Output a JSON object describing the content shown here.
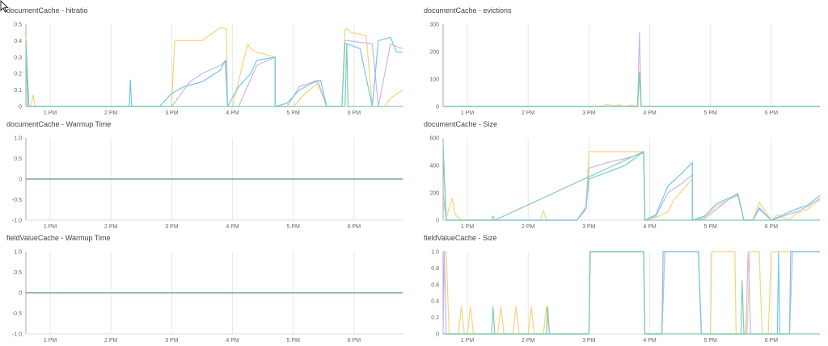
{
  "colors": {
    "yellow": "#f7d37a",
    "purple": "#c9b7e8",
    "cyan": "#6ccbe5",
    "green": "#7fcfa8",
    "grid": "#e8e8e8",
    "axis": "#aaaaaa"
  },
  "panels": [
    {
      "title": "documentCache - hitratio"
    },
    {
      "title": "documentCache - evictions"
    },
    {
      "title": "documentCache - Warmup Time"
    },
    {
      "title": "documentCache - Size"
    },
    {
      "title": "fieldValueCache - Warmup Time"
    },
    {
      "title": "fieldValueCache - Size"
    }
  ],
  "chart_data": [
    {
      "type": "line",
      "title": "documentCache - hitratio",
      "xlim": [
        12.6,
        18.8
      ],
      "ylim": [
        0,
        0.5
      ],
      "xticks": [
        13,
        14,
        15,
        16,
        17,
        18
      ],
      "xticklabels": [
        "1 PM",
        "2 PM",
        "3 PM",
        "4 PM",
        "5 PM",
        "6 PM"
      ],
      "yticks": [
        0,
        0.1,
        0.2,
        0.3,
        0.4,
        0.5
      ],
      "yticklabels": [
        "0",
        "0.1",
        "0.2",
        "0.3",
        "0.4",
        "0.5"
      ],
      "series": [
        {
          "color": "yellow",
          "x": [
            12.6,
            12.63,
            12.68,
            12.72,
            12.75,
            15.0,
            15.02,
            15.05,
            15.5,
            15.8,
            15.9,
            15.92,
            16.0,
            16.25,
            16.3,
            16.35,
            16.4,
            16.5,
            16.7,
            16.7,
            17.0,
            17.2,
            17.4,
            17.55,
            17.8,
            17.85,
            17.9,
            17.95,
            18.2,
            18.3,
            18.5,
            18.6,
            18.8
          ],
          "y": [
            0.42,
            0.0,
            0.0,
            0.07,
            0.0,
            0.0,
            0.2,
            0.4,
            0.4,
            0.48,
            0.47,
            0.0,
            0.0,
            0.38,
            0.35,
            0.34,
            0.33,
            0.32,
            0.3,
            0.0,
            0.0,
            0.08,
            0.14,
            0.0,
            0.0,
            0.47,
            0.47,
            0.45,
            0.43,
            0.0,
            0.0,
            0.05,
            0.1
          ]
        },
        {
          "color": "purple",
          "x": [
            12.6,
            12.65,
            13.2,
            13.4,
            14.2,
            15.0,
            15.3,
            15.5,
            15.8,
            15.9,
            15.92,
            16.1,
            16.4,
            16.7,
            16.7,
            16.9,
            17.1,
            17.4,
            17.55,
            17.8,
            17.85,
            17.9,
            18.3,
            18.4,
            18.6,
            18.8
          ],
          "y": [
            0.0,
            0.0,
            0.0,
            0.0,
            0.0,
            0.0,
            0.15,
            0.2,
            0.25,
            0.28,
            0.0,
            0.0,
            0.25,
            0.3,
            0.0,
            0.0,
            0.12,
            0.16,
            0.0,
            0.0,
            0.4,
            0.4,
            0.38,
            0.0,
            0.38,
            0.35
          ]
        },
        {
          "color": "cyan",
          "x": [
            12.6,
            12.65,
            13.2,
            14.3,
            14.32,
            14.34,
            14.8,
            15.0,
            15.2,
            15.5,
            15.8,
            15.88,
            15.92,
            16.1,
            16.3,
            16.4,
            16.7,
            16.7,
            16.9,
            17.1,
            17.3,
            17.45,
            17.55,
            17.8,
            17.85,
            17.9,
            18.1,
            18.3,
            18.4,
            18.6,
            18.7,
            18.8
          ],
          "y": [
            0.4,
            0.0,
            0.0,
            0.0,
            0.16,
            0.0,
            0.0,
            0.08,
            0.12,
            0.15,
            0.22,
            0.28,
            0.0,
            0.12,
            0.2,
            0.28,
            0.3,
            0.0,
            0.02,
            0.1,
            0.14,
            0.16,
            0.0,
            0.0,
            0.38,
            0.38,
            0.35,
            0.0,
            0.4,
            0.42,
            0.33,
            0.33
          ]
        },
        {
          "color": "green",
          "x": [
            12.6,
            12.63,
            17.85,
            17.88,
            17.9,
            17.95,
            18.8
          ],
          "y": [
            0.4,
            0.0,
            0.0,
            0.38,
            0.0,
            0.0,
            0.0
          ]
        }
      ]
    },
    {
      "type": "line",
      "title": "documentCache - evictions",
      "xlim": [
        12.6,
        18.8
      ],
      "ylim": [
        0,
        300
      ],
      "xticks": [
        13,
        14,
        15,
        16,
        17,
        18
      ],
      "xticklabels": [
        "1 PM",
        "2 PM",
        "3 PM",
        "4 PM",
        "5 PM",
        "6 PM"
      ],
      "yticks": [
        0,
        100,
        200,
        300
      ],
      "yticklabels": [
        "0",
        "100",
        "200",
        "300"
      ],
      "series": [
        {
          "color": "yellow",
          "x": [
            12.6,
            15.2,
            15.3,
            15.4,
            15.5,
            15.6,
            15.7,
            15.8,
            18.8
          ],
          "y": [
            0,
            0,
            8,
            2,
            6,
            0,
            5,
            0,
            0
          ]
        },
        {
          "color": "purple",
          "x": [
            12.6,
            15.8,
            15.83,
            15.86,
            18.8
          ],
          "y": [
            0,
            0,
            270,
            0,
            0
          ]
        },
        {
          "color": "cyan",
          "x": [
            12.6,
            15.8,
            15.83,
            15.86,
            18.8
          ],
          "y": [
            0,
            0,
            120,
            0,
            0
          ]
        },
        {
          "color": "green",
          "x": [
            12.6,
            15.8,
            15.83,
            15.86,
            18.8
          ],
          "y": [
            0,
            0,
            125,
            0,
            0
          ]
        }
      ]
    },
    {
      "type": "line",
      "title": "documentCache - Warmup Time",
      "xlim": [
        12.6,
        18.8
      ],
      "ylim": [
        -1.0,
        1.0
      ],
      "xticks": [
        13,
        14,
        15,
        16,
        17,
        18
      ],
      "xticklabels": [
        "1 PM",
        "2 PM",
        "3 PM",
        "4 PM",
        "5 PM",
        "6 PM"
      ],
      "yticks": [
        -1.0,
        -0.5,
        0,
        0.5,
        1.0
      ],
      "yticklabels": [
        "-1.0",
        "-0.5",
        "0",
        "0.5",
        "1.0"
      ],
      "series": [
        {
          "color": "cyan",
          "x": [
            12.6,
            18.8
          ],
          "y": [
            0,
            0
          ]
        },
        {
          "color": "green",
          "x": [
            12.6,
            18.8
          ],
          "y": [
            0,
            0
          ]
        }
      ]
    },
    {
      "type": "line",
      "title": "documentCache - Size",
      "xlim": [
        12.6,
        18.8
      ],
      "ylim": [
        0,
        600
      ],
      "xticks": [
        13,
        14,
        15,
        16,
        17,
        18
      ],
      "xticklabels": [
        "1 PM",
        "2 PM",
        "3 PM",
        "4 PM",
        "5 PM",
        "6 PM"
      ],
      "yticks": [
        0,
        200,
        400,
        600
      ],
      "yticklabels": [
        "0",
        "200",
        "400",
        "600"
      ],
      "series": [
        {
          "color": "yellow",
          "x": [
            12.6,
            12.65,
            12.75,
            12.8,
            12.9,
            13.0,
            13.5,
            14.0,
            14.2,
            14.25,
            14.3,
            14.8,
            14.95,
            15.0,
            15.5,
            15.9,
            15.92,
            16.1,
            16.3,
            16.4,
            16.6,
            16.7,
            16.7,
            16.9,
            17.1,
            17.3,
            17.45,
            17.55,
            17.7,
            17.8,
            18.0,
            18.1,
            18.3,
            18.4,
            18.6,
            18.8
          ],
          "y": [
            150,
            20,
            160,
            40,
            0,
            0,
            0,
            0,
            0,
            70,
            0,
            0,
            100,
            500,
            500,
            500,
            0,
            20,
            60,
            150,
            250,
            300,
            0,
            20,
            100,
            150,
            200,
            0,
            0,
            130,
            0,
            40,
            0,
            50,
            80,
            150
          ]
        },
        {
          "color": "purple",
          "x": [
            12.6,
            12.65,
            13.0,
            14.8,
            14.95,
            15.0,
            15.3,
            15.6,
            15.9,
            15.92,
            16.1,
            16.3,
            16.5,
            16.7,
            16.7,
            16.9,
            17.1,
            17.3,
            17.45,
            17.55,
            17.7,
            17.8,
            18.0,
            18.2,
            18.4,
            18.6,
            18.8
          ],
          "y": [
            200,
            0,
            0,
            0,
            90,
            380,
            420,
            450,
            490,
            0,
            30,
            200,
            260,
            330,
            0,
            10,
            80,
            150,
            180,
            0,
            0,
            80,
            0,
            30,
            60,
            100,
            160
          ]
        },
        {
          "color": "cyan",
          "x": [
            12.6,
            12.65,
            13.0,
            14.8,
            14.95,
            15.0,
            15.3,
            15.6,
            15.9,
            15.92,
            16.1,
            16.3,
            16.5,
            16.7,
            16.7,
            16.9,
            17.1,
            17.3,
            17.45,
            17.55,
            17.7,
            17.8,
            18.0,
            18.2,
            18.4,
            18.6,
            18.8
          ],
          "y": [
            500,
            0,
            0,
            0,
            80,
            300,
            350,
            400,
            500,
            0,
            40,
            250,
            330,
            420,
            0,
            30,
            120,
            160,
            190,
            0,
            0,
            90,
            0,
            40,
            80,
            110,
            180
          ]
        },
        {
          "color": "green",
          "x": [
            12.6,
            12.65,
            13.4,
            13.42,
            13.45,
            15.9,
            15.92,
            18.8
          ],
          "y": [
            550,
            0,
            0,
            30,
            0,
            500,
            0,
            0
          ]
        }
      ]
    },
    {
      "type": "line",
      "title": "fieldValueCache - Warmup Time",
      "xlim": [
        12.6,
        18.8
      ],
      "ylim": [
        -1.0,
        1.0
      ],
      "xticks": [
        13,
        14,
        15,
        16,
        17,
        18
      ],
      "xticklabels": [
        "1 PM",
        "2 PM",
        "3 PM",
        "4 PM",
        "5 PM",
        "6 PM"
      ],
      "yticks": [
        -1.0,
        -0.5,
        0,
        0.5,
        1.0
      ],
      "yticklabels": [
        "-1.0",
        "-0.5",
        "0",
        "0.5",
        "1.0"
      ],
      "series": [
        {
          "color": "cyan",
          "x": [
            12.6,
            18.8
          ],
          "y": [
            0,
            0
          ]
        },
        {
          "color": "green",
          "x": [
            12.6,
            18.8
          ],
          "y": [
            0,
            0
          ]
        }
      ]
    },
    {
      "type": "line",
      "title": "fieldValueCache - Size",
      "xlim": [
        12.6,
        18.8
      ],
      "ylim": [
        0,
        1.0
      ],
      "xticks": [
        13,
        14,
        15,
        16,
        17,
        18
      ],
      "xticklabels": [
        "1 PM",
        "2 PM",
        "3 PM",
        "4 PM",
        "5 PM",
        "6 PM"
      ],
      "yticks": [
        0,
        0.2,
        0.4,
        0.6,
        0.8,
        1.0
      ],
      "yticklabels": [
        "0",
        "0.2",
        "0.4",
        "0.6",
        "0.8",
        "1.0"
      ],
      "series": [
        {
          "color": "yellow",
          "x": [
            12.6,
            12.65,
            12.7,
            12.85,
            12.9,
            12.95,
            13.0,
            13.05,
            13.1,
            13.5,
            13.55,
            13.6,
            13.75,
            13.8,
            13.85,
            14.0,
            14.05,
            14.1,
            14.25,
            14.3,
            14.35,
            14.5,
            15.0,
            15.02,
            15.9,
            15.92,
            16.2,
            16.25,
            16.8,
            16.85,
            17.0,
            17.02,
            17.4,
            17.42,
            17.6,
            17.65,
            17.8,
            17.85,
            17.95,
            18.0,
            18.8
          ],
          "y": [
            1.0,
            1.0,
            0.0,
            0.0,
            0.33,
            0.0,
            0.0,
            0.33,
            0.0,
            0.0,
            0.33,
            0.0,
            0.0,
            0.33,
            0.0,
            0.0,
            0.33,
            0.0,
            0.0,
            0.33,
            0.0,
            0.0,
            0.0,
            1.0,
            1.0,
            0.0,
            0.0,
            1.0,
            1.0,
            0.0,
            0.0,
            1.0,
            1.0,
            0.0,
            0.0,
            1.0,
            1.0,
            0.0,
            0.0,
            1.0,
            1.0
          ]
        },
        {
          "color": "purple",
          "x": [
            12.6,
            12.62,
            12.65,
            15.0,
            15.02,
            15.9,
            15.92,
            16.2,
            16.25,
            16.8,
            16.85,
            17.58,
            17.62,
            17.66,
            17.9,
            17.95,
            18.3,
            18.35,
            18.8
          ],
          "y": [
            0.0,
            1.0,
            0.0,
            0.0,
            1.0,
            1.0,
            0.0,
            0.0,
            1.0,
            1.0,
            0.0,
            0.0,
            1.0,
            0.0,
            0.0,
            0.0,
            0.0,
            1.0,
            1.0
          ]
        },
        {
          "color": "cyan",
          "x": [
            12.6,
            15.0,
            15.02,
            15.9,
            15.92,
            16.2,
            16.22,
            16.8,
            16.85,
            18.1,
            18.12,
            18.14,
            18.3,
            18.32,
            18.8
          ],
          "y": [
            0.0,
            0.0,
            1.0,
            1.0,
            0.0,
            0.0,
            1.0,
            1.0,
            0.0,
            0.0,
            1.0,
            0.0,
            0.0,
            1.0,
            1.0
          ]
        },
        {
          "color": "green",
          "x": [
            12.6,
            13.4,
            13.42,
            13.45,
            14.3,
            14.32,
            14.35,
            15.0,
            15.02,
            15.9,
            15.92,
            17.5,
            17.52,
            17.55,
            18.8
          ],
          "y": [
            0.0,
            0.0,
            0.33,
            0.0,
            0.0,
            0.33,
            0.0,
            0.0,
            1.0,
            1.0,
            0.0,
            0.0,
            0.65,
            0.0,
            0.0
          ]
        }
      ]
    }
  ]
}
